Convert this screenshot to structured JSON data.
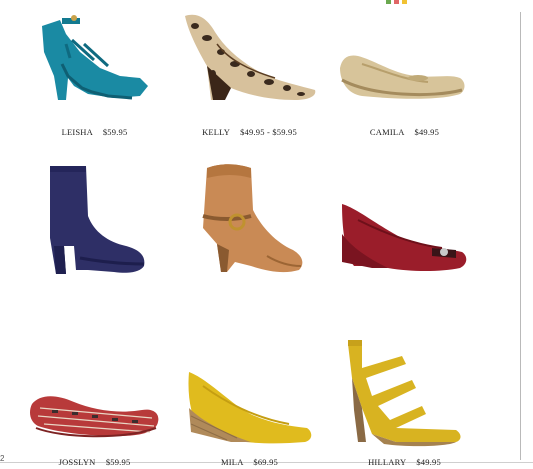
{
  "products": [
    {
      "name": "LEISHA",
      "price": "$59.95",
      "color": "#1a8aa3"
    },
    {
      "name": "KELLY",
      "price": "$49.95 - $59.95",
      "color": "#c8a06a"
    },
    {
      "name": "CAMILA",
      "price": "$49.95",
      "color": "#d7c49a"
    },
    {
      "name": "JOSSLYN",
      "price": "$59.95",
      "color": "#2e2f66"
    },
    {
      "name": "MILA",
      "price": "$69.95",
      "color": "#c98a55"
    },
    {
      "name": "HILLARY",
      "price": "$49.95",
      "color": "#9a1d2a"
    },
    {
      "color": "#b83a3a"
    },
    {
      "color": "#e0bb1e"
    },
    {
      "color": "#d8b321"
    }
  ],
  "corner_glyph": "2"
}
